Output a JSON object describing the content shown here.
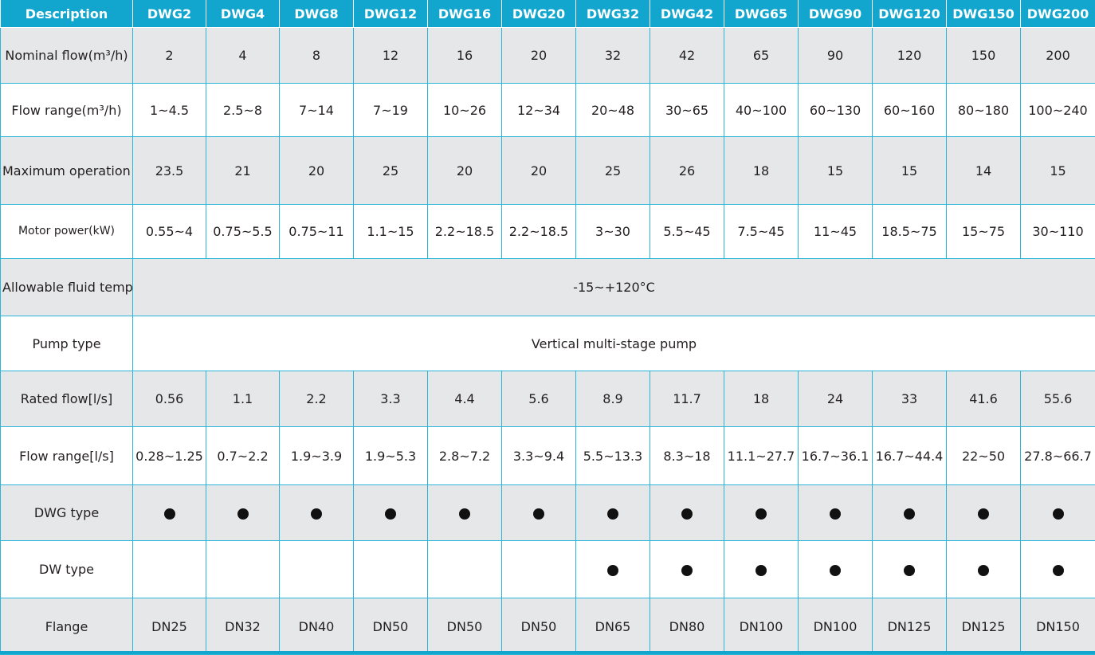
{
  "columns": [
    "Description",
    "DWG2",
    "DWG4",
    "DWG8",
    "DWG12",
    "DWG16",
    "DWG20",
    "DWG32",
    "DWG42",
    "DWG65",
    "DWG90",
    "DWG120",
    "DWG150",
    "DWG200"
  ],
  "rows": {
    "nominal_flow": {
      "label": "Nominal flow(m³/h)",
      "values": [
        "2",
        "4",
        "8",
        "12",
        "16",
        "20",
        "32",
        "42",
        "65",
        "90",
        "120",
        "150",
        "200"
      ]
    },
    "flow_range_m3h": {
      "label": "Flow range(m³/h)",
      "values": [
        "1~4.5",
        "2.5~8",
        "7~14",
        "7~19",
        "10~26",
        "12~34",
        "20~48",
        "30~65",
        "40~100",
        "60~130",
        "60~160",
        "80~180",
        "100~240"
      ]
    },
    "max_pressure": {
      "label": "Maximum operation pressure(bar)",
      "values": [
        "23.5",
        "21",
        "20",
        "25",
        "20",
        "20",
        "25",
        "26",
        "18",
        "15",
        "15",
        "14",
        "15"
      ]
    },
    "motor_power": {
      "label": "Motor power(kW)",
      "values": [
        "0.55~4",
        "0.75~5.5",
        "0.75~11",
        "1.1~15",
        "2.2~18.5",
        "2.2~18.5",
        "3~30",
        "5.5~45",
        "7.5~45",
        "11~45",
        "18.5~75",
        "15~75",
        "30~110"
      ]
    },
    "fluid_temp": {
      "label": "Allowable fluid temperature(°C)",
      "value": "-15~+120°C"
    },
    "pump_type": {
      "label": "Pump type",
      "value": "Vertical multi-stage pump"
    },
    "rated_flow": {
      "label": "Rated flow[l/s]",
      "values": [
        "0.56",
        "1.1",
        "2.2",
        "3.3",
        "4.4",
        "5.6",
        "8.9",
        "11.7",
        "18",
        "24",
        "33",
        "41.6",
        "55.6"
      ]
    },
    "flow_range_ls": {
      "label": "Flow range[l/s]",
      "values": [
        "0.28~1.25",
        "0.7~2.2",
        "1.9~3.9",
        "1.9~5.3",
        "2.8~7.2",
        "3.3~9.4",
        "5.5~13.3",
        "8.3~18",
        "11.1~27.7",
        "16.7~36.1",
        "16.7~44.4",
        "22~50",
        "27.8~66.7"
      ]
    },
    "dwg_type": {
      "label": "DWG type",
      "values": [
        true,
        true,
        true,
        true,
        true,
        true,
        true,
        true,
        true,
        true,
        true,
        true,
        true
      ]
    },
    "dw_type": {
      "label": "DW type",
      "values": [
        false,
        false,
        false,
        false,
        false,
        false,
        true,
        true,
        true,
        true,
        true,
        true,
        true
      ]
    },
    "flange": {
      "label": "Flange",
      "values": [
        "DN25",
        "DN32",
        "DN40",
        "DN50",
        "DN50",
        "DN50",
        "DN65",
        "DN80",
        "DN100",
        "DN100",
        "DN125",
        "DN125",
        "DN150"
      ]
    }
  },
  "colors": {
    "header_bg": "#12a6cf",
    "border": "#2bb5d8",
    "stripe": "#e6e7e8"
  }
}
